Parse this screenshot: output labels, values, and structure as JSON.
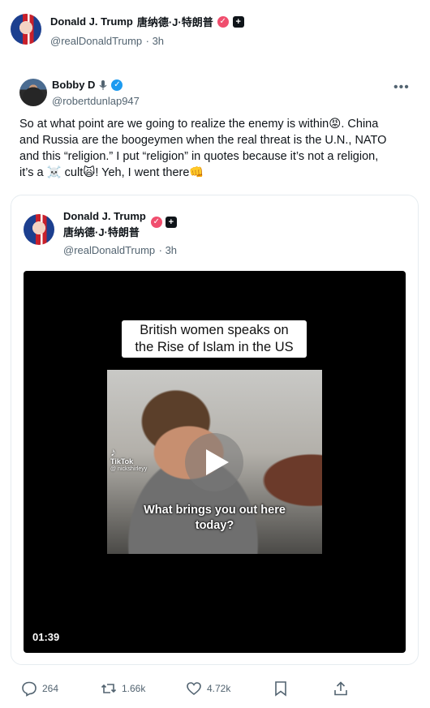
{
  "top_post": {
    "author_name": "Donald J. Trump",
    "author_name_cn": "唐纳德·J·特朗普",
    "handle": "@realDonaldTrump",
    "time": "3h"
  },
  "quoted_post": {
    "author_name": "Bobby D",
    "handle": "@robertdunlap947",
    "text_line1": "So at what point are we going to realize the enemy is within😡. China",
    "text_line2": "and Russia are the boogeymen when the real threat is the U.N., NATO",
    "text_line3": "and this “religion.” I put “religion” in quotes because it’s not a religion,",
    "text_line4": "it’s a ☠️ cult🙀! Yeh, I went there👊"
  },
  "embedded_post": {
    "author_name": "Donald J. Trump",
    "author_name_cn": "唐纳德·J·特朗普",
    "handle": "@realDonaldTrump",
    "time": "3h",
    "video": {
      "title_line1": "British women speaks on",
      "title_line2": "the Rise of Islam in the US",
      "caption_line1": "What brings you out here",
      "caption_line2": "today?",
      "watermark": "TikTok",
      "watermark_user": "@ nickshirleyy",
      "duration": "01:39"
    }
  },
  "actions": {
    "replies": "264",
    "reposts": "1.66k",
    "likes": "4.72k"
  },
  "icons": [
    "verified-badge",
    "subscriber-badge",
    "microphone-icon",
    "more-icon",
    "play-icon",
    "reply-icon",
    "repost-icon",
    "like-icon",
    "bookmark-icon",
    "share-icon"
  ]
}
